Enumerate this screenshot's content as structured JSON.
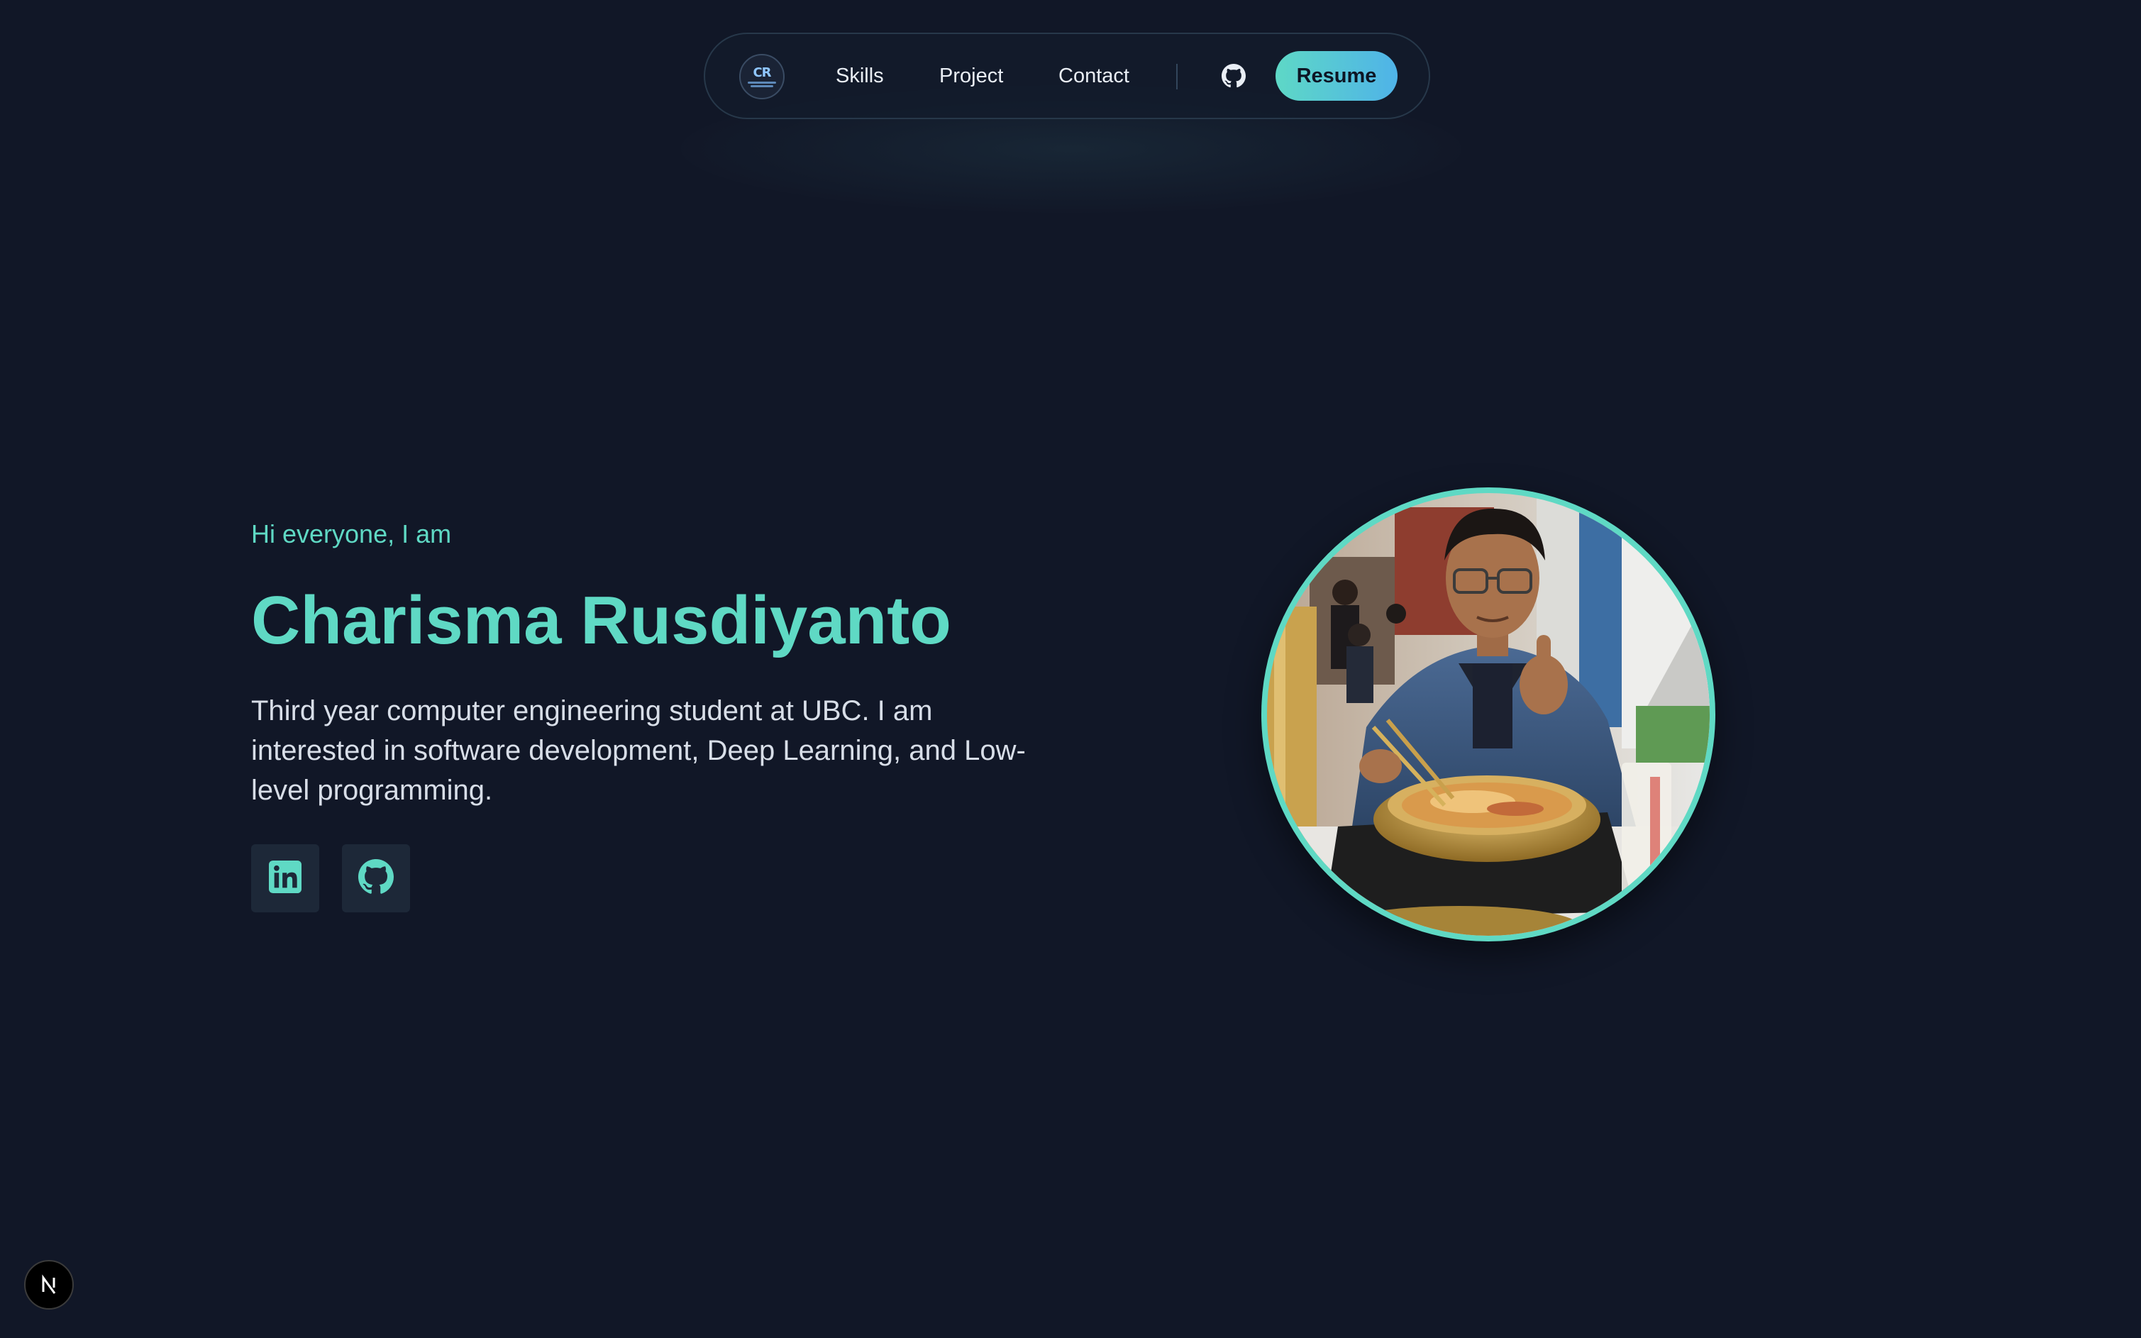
{
  "nav": {
    "logo_text": "CR",
    "links": [
      {
        "label": "Skills"
      },
      {
        "label": "Project"
      },
      {
        "label": "Contact"
      }
    ],
    "github_icon": "github-icon",
    "resume_label": "Resume"
  },
  "hero": {
    "greeting": "Hi everyone, I am",
    "name": "Charisma Rusdiyanto",
    "description": "Third year computer engineering student at UBC. I am interested in software development, Deep Learning, and Low-level programming.",
    "socials": [
      {
        "icon": "linkedin-icon"
      },
      {
        "icon": "github-icon"
      }
    ]
  },
  "photo": {
    "alt": "Profile photo"
  },
  "badge": {
    "label": "N"
  },
  "colors": {
    "background": "#111727",
    "accent": "#5fd9c4",
    "resume_gradient_start": "#5ed8c6",
    "resume_gradient_end": "#4fb3e8",
    "social_button_bg": "#1d2838"
  }
}
